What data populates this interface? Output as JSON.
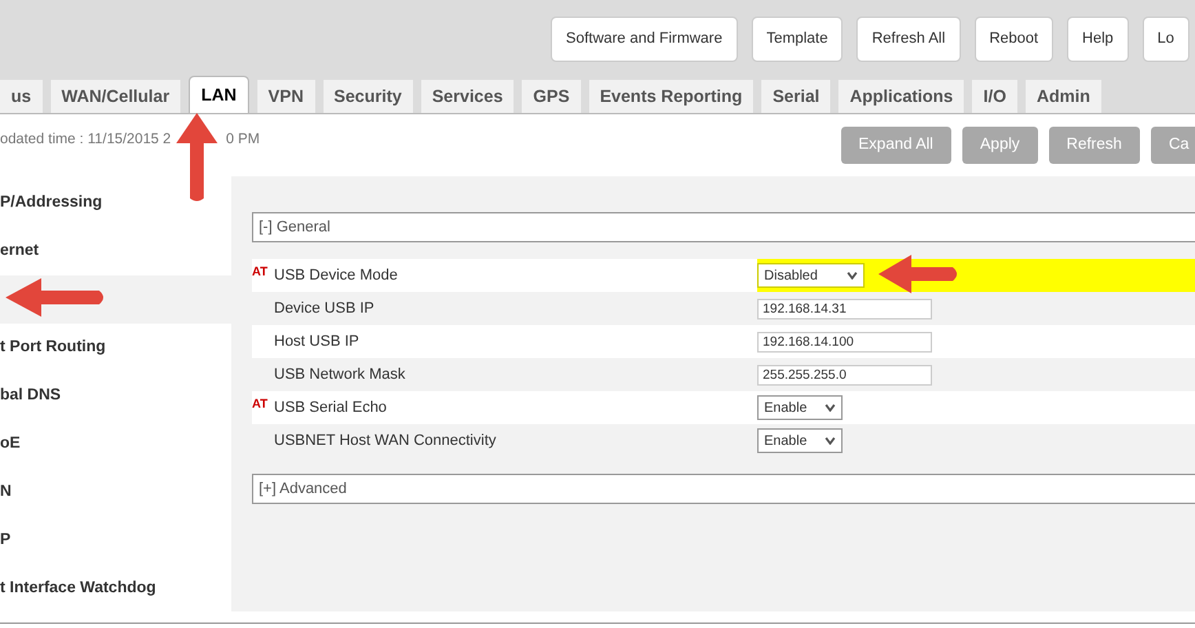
{
  "header_buttons": [
    "Software and Firmware",
    "Template",
    "Refresh All",
    "Reboot",
    "Help",
    "Lo"
  ],
  "tabs": [
    {
      "label": "us",
      "selected": false
    },
    {
      "label": "WAN/Cellular",
      "selected": false
    },
    {
      "label": "LAN",
      "selected": true
    },
    {
      "label": "VPN",
      "selected": false
    },
    {
      "label": "Security",
      "selected": false
    },
    {
      "label": "Services",
      "selected": false
    },
    {
      "label": "GPS",
      "selected": false
    },
    {
      "label": "Events Reporting",
      "selected": false
    },
    {
      "label": "Serial",
      "selected": false
    },
    {
      "label": "Applications",
      "selected": false
    },
    {
      "label": "I/O",
      "selected": false
    },
    {
      "label": "Admin",
      "selected": false
    }
  ],
  "updated_time": [
    "odated time : 11/15/2015 2",
    "0 PM"
  ],
  "action_buttons": [
    "Expand All",
    "Apply",
    "Refresh",
    "Ca"
  ],
  "sidebar": {
    "items": [
      {
        "label": "P/Addressing",
        "selected": false
      },
      {
        "label": "ernet",
        "selected": false
      },
      {
        "selected": true
      },
      {
        "label": "t Port Routing",
        "selected": false
      },
      {
        "label": "bal DNS",
        "selected": false
      },
      {
        "label": "oE",
        "selected": false
      },
      {
        "label": "N",
        "selected": false
      },
      {
        "label": "P",
        "selected": false
      },
      {
        "label": "t Interface Watchdog",
        "selected": false
      }
    ]
  },
  "sections": [
    {
      "title": "[-] General",
      "expanded": true,
      "rows": [
        {
          "label": "USB Device Mode",
          "at": "AT",
          "kind": "select",
          "value": "Disabled",
          "highlighted": true
        },
        {
          "label": "Device USB IP",
          "kind": "text",
          "value": "192.168.14.31",
          "highlighted": false
        },
        {
          "label": "Host USB IP",
          "kind": "text",
          "value": "192.168.14.100",
          "highlighted": false
        },
        {
          "label": "USB Network Mask",
          "kind": "text",
          "value": "255.255.255.0",
          "highlighted": false
        },
        {
          "label": "USB Serial Echo",
          "at": "AT",
          "kind": "select",
          "value": "Enable",
          "highlighted": false
        },
        {
          "label": "USBNET Host WAN Connectivity",
          "kind": "select",
          "value": "Enable",
          "highlighted": false
        }
      ]
    },
    {
      "title": "[+] Advanced",
      "expanded": false
    }
  ]
}
